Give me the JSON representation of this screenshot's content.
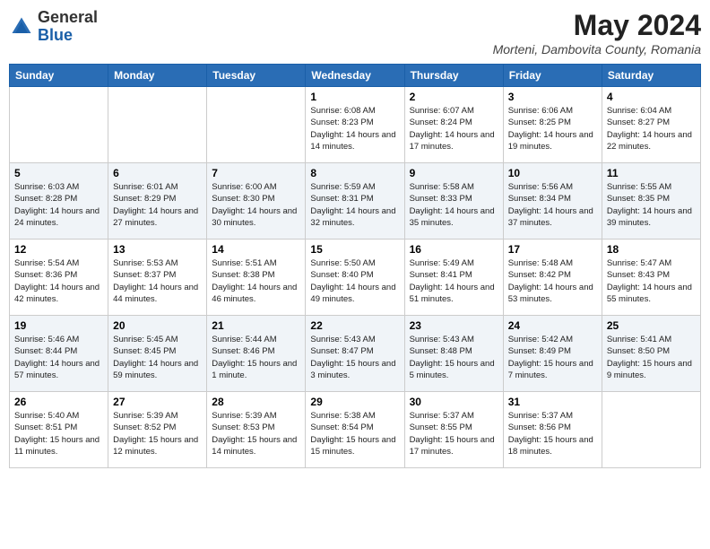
{
  "logo": {
    "general": "General",
    "blue": "Blue"
  },
  "title": {
    "month_year": "May 2024",
    "location": "Morteni, Dambovita County, Romania"
  },
  "days_of_week": [
    "Sunday",
    "Monday",
    "Tuesday",
    "Wednesday",
    "Thursday",
    "Friday",
    "Saturday"
  ],
  "weeks": [
    [
      {
        "day": "",
        "info": ""
      },
      {
        "day": "",
        "info": ""
      },
      {
        "day": "",
        "info": ""
      },
      {
        "day": "1",
        "info": "Sunrise: 6:08 AM\nSunset: 8:23 PM\nDaylight: 14 hours and 14 minutes."
      },
      {
        "day": "2",
        "info": "Sunrise: 6:07 AM\nSunset: 8:24 PM\nDaylight: 14 hours and 17 minutes."
      },
      {
        "day": "3",
        "info": "Sunrise: 6:06 AM\nSunset: 8:25 PM\nDaylight: 14 hours and 19 minutes."
      },
      {
        "day": "4",
        "info": "Sunrise: 6:04 AM\nSunset: 8:27 PM\nDaylight: 14 hours and 22 minutes."
      }
    ],
    [
      {
        "day": "5",
        "info": "Sunrise: 6:03 AM\nSunset: 8:28 PM\nDaylight: 14 hours and 24 minutes."
      },
      {
        "day": "6",
        "info": "Sunrise: 6:01 AM\nSunset: 8:29 PM\nDaylight: 14 hours and 27 minutes."
      },
      {
        "day": "7",
        "info": "Sunrise: 6:00 AM\nSunset: 8:30 PM\nDaylight: 14 hours and 30 minutes."
      },
      {
        "day": "8",
        "info": "Sunrise: 5:59 AM\nSunset: 8:31 PM\nDaylight: 14 hours and 32 minutes."
      },
      {
        "day": "9",
        "info": "Sunrise: 5:58 AM\nSunset: 8:33 PM\nDaylight: 14 hours and 35 minutes."
      },
      {
        "day": "10",
        "info": "Sunrise: 5:56 AM\nSunset: 8:34 PM\nDaylight: 14 hours and 37 minutes."
      },
      {
        "day": "11",
        "info": "Sunrise: 5:55 AM\nSunset: 8:35 PM\nDaylight: 14 hours and 39 minutes."
      }
    ],
    [
      {
        "day": "12",
        "info": "Sunrise: 5:54 AM\nSunset: 8:36 PM\nDaylight: 14 hours and 42 minutes."
      },
      {
        "day": "13",
        "info": "Sunrise: 5:53 AM\nSunset: 8:37 PM\nDaylight: 14 hours and 44 minutes."
      },
      {
        "day": "14",
        "info": "Sunrise: 5:51 AM\nSunset: 8:38 PM\nDaylight: 14 hours and 46 minutes."
      },
      {
        "day": "15",
        "info": "Sunrise: 5:50 AM\nSunset: 8:40 PM\nDaylight: 14 hours and 49 minutes."
      },
      {
        "day": "16",
        "info": "Sunrise: 5:49 AM\nSunset: 8:41 PM\nDaylight: 14 hours and 51 minutes."
      },
      {
        "day": "17",
        "info": "Sunrise: 5:48 AM\nSunset: 8:42 PM\nDaylight: 14 hours and 53 minutes."
      },
      {
        "day": "18",
        "info": "Sunrise: 5:47 AM\nSunset: 8:43 PM\nDaylight: 14 hours and 55 minutes."
      }
    ],
    [
      {
        "day": "19",
        "info": "Sunrise: 5:46 AM\nSunset: 8:44 PM\nDaylight: 14 hours and 57 minutes."
      },
      {
        "day": "20",
        "info": "Sunrise: 5:45 AM\nSunset: 8:45 PM\nDaylight: 14 hours and 59 minutes."
      },
      {
        "day": "21",
        "info": "Sunrise: 5:44 AM\nSunset: 8:46 PM\nDaylight: 15 hours and 1 minute."
      },
      {
        "day": "22",
        "info": "Sunrise: 5:43 AM\nSunset: 8:47 PM\nDaylight: 15 hours and 3 minutes."
      },
      {
        "day": "23",
        "info": "Sunrise: 5:43 AM\nSunset: 8:48 PM\nDaylight: 15 hours and 5 minutes."
      },
      {
        "day": "24",
        "info": "Sunrise: 5:42 AM\nSunset: 8:49 PM\nDaylight: 15 hours and 7 minutes."
      },
      {
        "day": "25",
        "info": "Sunrise: 5:41 AM\nSunset: 8:50 PM\nDaylight: 15 hours and 9 minutes."
      }
    ],
    [
      {
        "day": "26",
        "info": "Sunrise: 5:40 AM\nSunset: 8:51 PM\nDaylight: 15 hours and 11 minutes."
      },
      {
        "day": "27",
        "info": "Sunrise: 5:39 AM\nSunset: 8:52 PM\nDaylight: 15 hours and 12 minutes."
      },
      {
        "day": "28",
        "info": "Sunrise: 5:39 AM\nSunset: 8:53 PM\nDaylight: 15 hours and 14 minutes."
      },
      {
        "day": "29",
        "info": "Sunrise: 5:38 AM\nSunset: 8:54 PM\nDaylight: 15 hours and 15 minutes."
      },
      {
        "day": "30",
        "info": "Sunrise: 5:37 AM\nSunset: 8:55 PM\nDaylight: 15 hours and 17 minutes."
      },
      {
        "day": "31",
        "info": "Sunrise: 5:37 AM\nSunset: 8:56 PM\nDaylight: 15 hours and 18 minutes."
      },
      {
        "day": "",
        "info": ""
      }
    ]
  ]
}
